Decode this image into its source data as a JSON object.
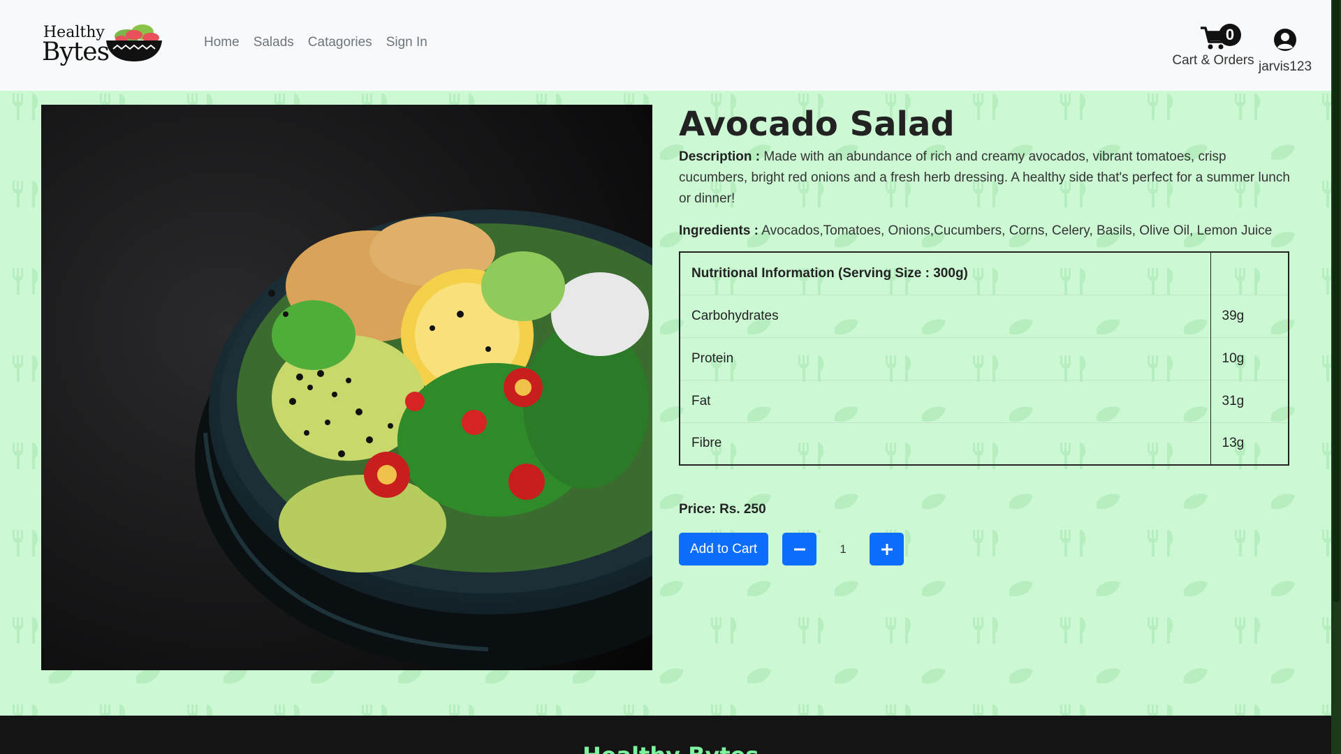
{
  "brand": {
    "line1": "Healthy",
    "line2": "Bytes"
  },
  "nav": {
    "items": [
      {
        "label": "Home"
      },
      {
        "label": "Salads"
      },
      {
        "label": "Catagories"
      },
      {
        "label": "Sign In"
      }
    ]
  },
  "cart": {
    "count": "0",
    "label": "Cart & Orders"
  },
  "user": {
    "name": "jarvis123"
  },
  "product": {
    "title": "Avocado Salad",
    "description_label": "Description :",
    "description": "Made with an abundance of rich and creamy avocados, vibrant tomatoes, crisp cucumbers, bright red onions and a fresh herb dressing. A healthy side that's perfect for a summer lunch or dinner!",
    "ingredients_label": "Ingredients :",
    "ingredients": "Avocados,Tomatoes, Onions,Cucumbers, Corns, Celery, Basils, Olive Oil, Lemon Juice",
    "nutrition": {
      "header": "Nutritional Information (Serving Size : 300g)",
      "rows": [
        {
          "name": "Carbohydrates",
          "value": "39g"
        },
        {
          "name": "Protein",
          "value": "10g"
        },
        {
          "name": "Fat",
          "value": "31g"
        },
        {
          "name": "Fibre",
          "value": "13g"
        }
      ]
    },
    "price": "Price: Rs. 250",
    "add_to_cart_label": "Add to Cart",
    "quantity": "1"
  },
  "footer": {
    "brand": "Healthy Bytes"
  },
  "colors": {
    "accent": "#0d6efd",
    "page_bg": "#ccf8d4",
    "footer_bg": "#141414",
    "footer_text": "#7ff2a0"
  },
  "icons": [
    "cart-icon",
    "user-icon",
    "minus-icon",
    "plus-icon",
    "salad-bowl-logo"
  ]
}
